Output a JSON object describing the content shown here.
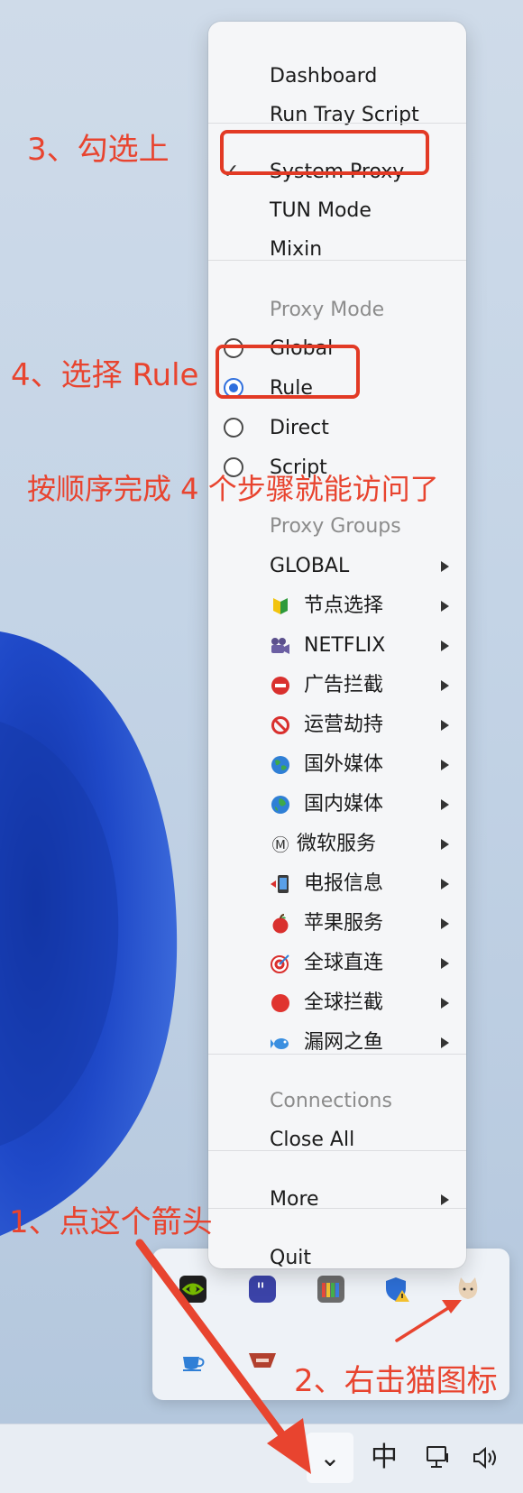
{
  "menu": {
    "dashboard": "Dashboard",
    "run_tray_script": "Run Tray Script",
    "system_proxy": "System Proxy",
    "system_proxy_checked": true,
    "tun_mode": "TUN Mode",
    "mixin": "Mixin",
    "proxy_mode_header": "Proxy Mode",
    "modes": [
      {
        "label": "Global",
        "selected": false
      },
      {
        "label": "Rule",
        "selected": true
      },
      {
        "label": "Direct",
        "selected": false
      },
      {
        "label": "Script",
        "selected": false
      }
    ],
    "proxy_groups_header": "Proxy Groups",
    "groups": [
      {
        "label": "GLOBAL",
        "icon": ""
      },
      {
        "label": "节点选择",
        "icon": "beginner-badge-icon"
      },
      {
        "label": "NETFLIX",
        "icon": "movie-camera-icon"
      },
      {
        "label": "广告拦截",
        "icon": "no-entry-icon"
      },
      {
        "label": "运营劫持",
        "icon": "prohibited-icon"
      },
      {
        "label": "国外媒体",
        "icon": "globe-europe-icon"
      },
      {
        "label": "国内媒体",
        "icon": "globe-asia-icon"
      },
      {
        "label": "微软服务",
        "icon": "circled-m-icon"
      },
      {
        "label": "电报信息",
        "icon": "mobile-arrow-icon"
      },
      {
        "label": "苹果服务",
        "icon": "apple-icon"
      },
      {
        "label": "全球直连",
        "icon": "target-icon"
      },
      {
        "label": "全球拦截",
        "icon": "red-circle-icon"
      },
      {
        "label": "漏网之鱼",
        "icon": "fish-icon"
      }
    ],
    "connections_header": "Connections",
    "close_all": "Close All",
    "more": "More",
    "quit": "Quit"
  },
  "tray": {
    "icons": [
      "nvidia-icon",
      "quote-app-icon",
      "color-bars-icon",
      "security-shield-icon",
      "cat-icon",
      "coffee-cup-icon",
      "app-logo-icon"
    ]
  },
  "taskbar": {
    "chevron": "⌄",
    "ime": "中"
  },
  "annotations": {
    "step1": "1、点这个箭头",
    "step2": "2、右击猫图标",
    "step3": "3、勾选上",
    "step4": "4、选择 Rule",
    "summary": "按顺序完成 4 个步骤就能访问了"
  },
  "colors": {
    "annotation": "#e8442f",
    "radio_selected": "#2f6fdd",
    "wallpaper_bloom": "#1f49c8"
  }
}
